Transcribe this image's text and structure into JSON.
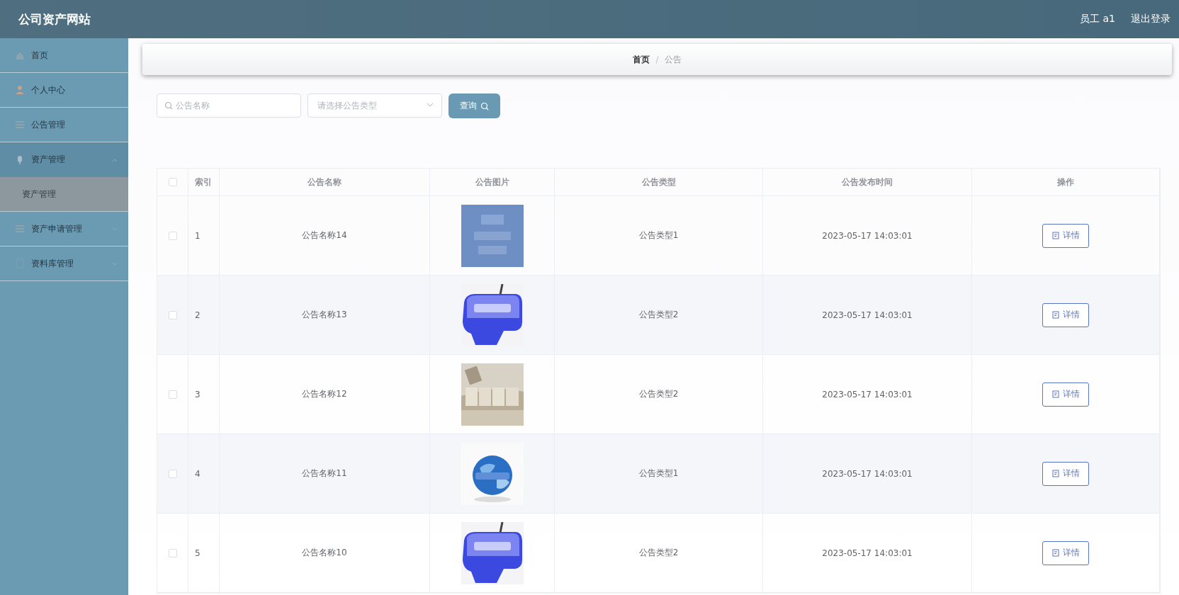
{
  "header": {
    "title": "公司资产网站",
    "user": "员工 a1",
    "logout": "退出登录"
  },
  "sidebar": {
    "items": [
      {
        "label": "首页",
        "kind": "link"
      },
      {
        "label": "个人中心",
        "kind": "link"
      },
      {
        "label": "公告管理",
        "kind": "link"
      },
      {
        "label": "资产管理",
        "kind": "submenu",
        "expanded": true,
        "children": [
          {
            "label": "资产管理",
            "selected": true
          }
        ]
      },
      {
        "label": "资产申请管理",
        "kind": "submenu",
        "expanded": false
      },
      {
        "label": "资料库管理",
        "kind": "submenu",
        "expanded": false
      }
    ]
  },
  "breadcrumb": {
    "items": [
      "首页",
      "公告"
    ],
    "separator": "/"
  },
  "search": {
    "name_placeholder": "公告名称",
    "type_placeholder": "请选择公告类型",
    "button": "查询"
  },
  "table": {
    "all_checked": false,
    "columns": [
      "索引",
      "公告名称",
      "公告图片",
      "公告类型",
      "公告发布时间",
      "操作"
    ],
    "rows": [
      {
        "checked": false,
        "index": "1",
        "name": "公告名称14",
        "type": "公告类型1",
        "time": "2023-05-17 14:03:01",
        "action": "详情"
      },
      {
        "checked": false,
        "index": "2",
        "name": "公告名称13",
        "type": "公告类型2",
        "time": "2023-05-17 14:03:01",
        "action": "详情"
      },
      {
        "checked": false,
        "index": "3",
        "name": "公告名称12",
        "type": "公告类型2",
        "time": "2023-05-17 14:03:01",
        "action": "详情"
      },
      {
        "checked": false,
        "index": "4",
        "name": "公告名称11",
        "type": "公告类型1",
        "time": "2023-05-17 14:03:01",
        "action": "详情"
      },
      {
        "checked": false,
        "index": "5",
        "name": "公告名称10",
        "type": "公告类型2",
        "time": "2023-05-17 14:03:01",
        "action": "详情"
      }
    ]
  }
}
